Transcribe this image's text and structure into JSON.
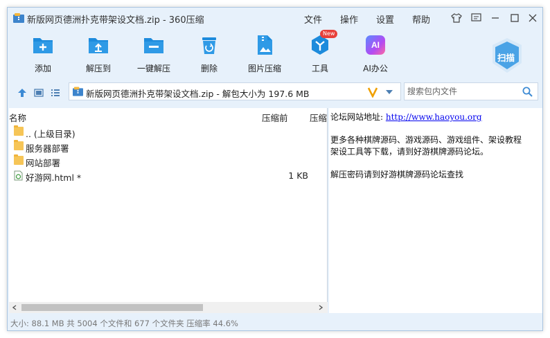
{
  "window": {
    "title": "新版网页德洲扑克带架设文档.zip - 360压缩",
    "menus": [
      "文件",
      "操作",
      "设置",
      "帮助"
    ]
  },
  "toolbar": {
    "items": [
      {
        "label": "添加",
        "icon": "add-icon"
      },
      {
        "label": "解压到",
        "icon": "extract-to-icon"
      },
      {
        "label": "一键解压",
        "icon": "one-click-extract-icon"
      },
      {
        "label": "删除",
        "icon": "delete-icon"
      },
      {
        "label": "图片压缩",
        "icon": "image-compress-icon"
      },
      {
        "label": "工具",
        "icon": "tools-icon",
        "badge": "New"
      },
      {
        "label": "AI办公",
        "icon": "ai-office-icon",
        "icon_text": "AI"
      }
    ],
    "scan_label": "扫描"
  },
  "address": {
    "path": "新版网页德洲扑克带架设文档.zip - 解包大小为 197.6 MB"
  },
  "search": {
    "placeholder": "搜索包内文件"
  },
  "file_list": {
    "columns": [
      "名称",
      "压缩前",
      "压缩"
    ],
    "rows": [
      {
        "name": ".. (上级目录)",
        "size": "",
        "type": "folder"
      },
      {
        "name": "服务器部署",
        "size": "",
        "type": "folder"
      },
      {
        "name": "网站部署",
        "size": "",
        "type": "folder"
      },
      {
        "name": "好游网.html *",
        "size": "1 KB",
        "type": "html"
      }
    ]
  },
  "comment": {
    "line1_label": "论坛网站地址:",
    "line1_link": "http://www.haoyou.org",
    "line2": "更多各种棋牌源码、游戏源码、游戏组件、架设教程",
    "line3": "架设工具等下载，请到好游棋牌源码论坛。",
    "line4": "解压密码请到好游棋牌源码论坛查找"
  },
  "status": {
    "text": "大小: 88.1 MB 共 5004 个文件和 677 个文件夹 压缩率 44.6%"
  },
  "colors": {
    "window_bg": "#e7f1fb",
    "accent": "#1d8bdc",
    "scan_bg": "#4aa3e6",
    "badge": "#e8403a"
  }
}
